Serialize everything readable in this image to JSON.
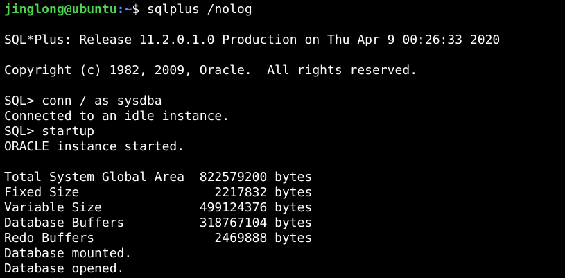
{
  "terminal": {
    "prompt_user_host": "jinglong@ubuntu",
    "prompt_path": ":~",
    "prompt_symbol": "$ ",
    "command": "sqlplus /nolog",
    "lines": {
      "release": "SQL*Plus: Release 11.2.0.1.0 Production on Thu Apr 9 00:26:33 2020",
      "copyright": "Copyright (c) 1982, 2009, Oracle.  All rights reserved.",
      "conn_cmd": "SQL> conn / as sysdba",
      "connected": "Connected to an idle instance.",
      "startup_cmd": "SQL> startup",
      "instance_started": "ORACLE instance started.",
      "sga_total": "Total System Global Area  822579200 bytes",
      "fixed_size": "Fixed Size                  2217832 bytes",
      "variable_size": "Variable Size             499124376 bytes",
      "db_buffers": "Database Buffers          318767104 bytes",
      "redo_buffers": "Redo Buffers                2469888 bytes",
      "mounted": "Database mounted.",
      "opened": "Database opened."
    }
  },
  "colors": {
    "background": "#000000",
    "text": "#ffffff",
    "prompt_user": "#4fd44f",
    "prompt_path": "#5f8fff"
  }
}
